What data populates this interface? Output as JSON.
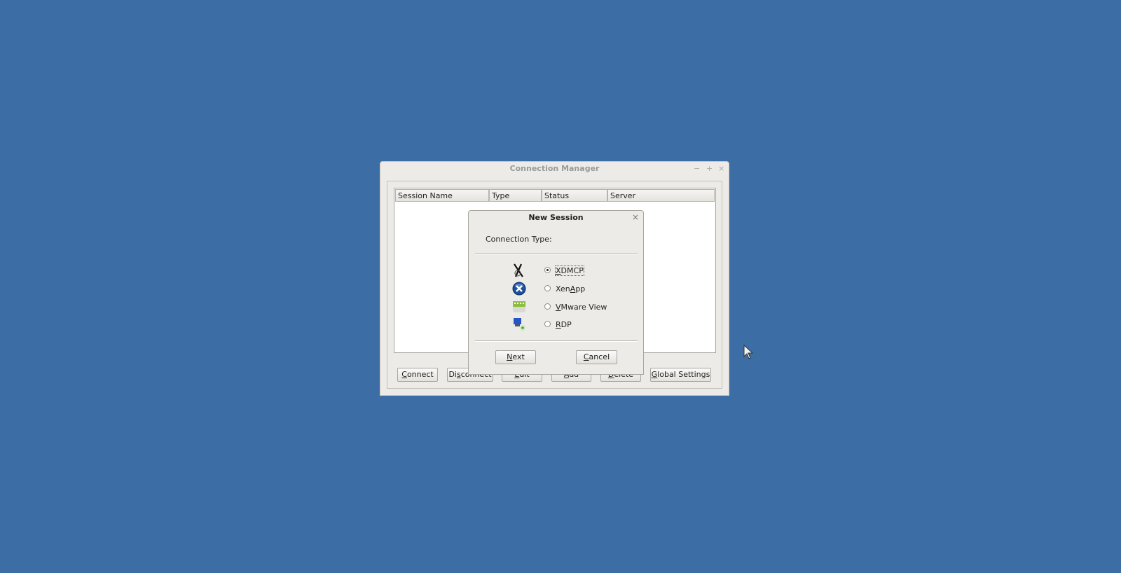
{
  "main_window": {
    "title": "Connection Manager",
    "controls": {
      "minimize": "−",
      "maximize": "+",
      "close": "×"
    },
    "table": {
      "columns": [
        "Session Name",
        "Type",
        "Status",
        "Server"
      ],
      "rows": []
    },
    "buttons": [
      {
        "label": "Connect",
        "mnemonic": 0
      },
      {
        "label": "Disconnect",
        "mnemonic": 2
      },
      {
        "label": "Edit",
        "mnemonic": 0
      },
      {
        "label": "Add",
        "mnemonic": 0
      },
      {
        "label": "Delete",
        "mnemonic": 0
      },
      {
        "label": "Global Settings",
        "mnemonic": 0
      }
    ]
  },
  "dialog": {
    "title": "New Session",
    "close": "×",
    "section_label": "Connection Type:",
    "options": [
      {
        "label": "XDMCP",
        "mnemonic": 0,
        "selected": true,
        "icon": "x11-icon"
      },
      {
        "label": "XenApp",
        "mnemonic": 3,
        "selected": false,
        "icon": "citrix-xenapp-icon"
      },
      {
        "label": "VMware View",
        "mnemonic": 0,
        "selected": false,
        "icon": "vmware-view-icon"
      },
      {
        "label": "RDP",
        "mnemonic": 0,
        "selected": false,
        "icon": "rdp-icon"
      }
    ],
    "next": {
      "label": "Next",
      "mnemonic": 0
    },
    "cancel": {
      "label": "Cancel",
      "mnemonic": 0
    }
  },
  "colors": {
    "desktop": "#3c6ea5",
    "window": "#edebe7"
  }
}
